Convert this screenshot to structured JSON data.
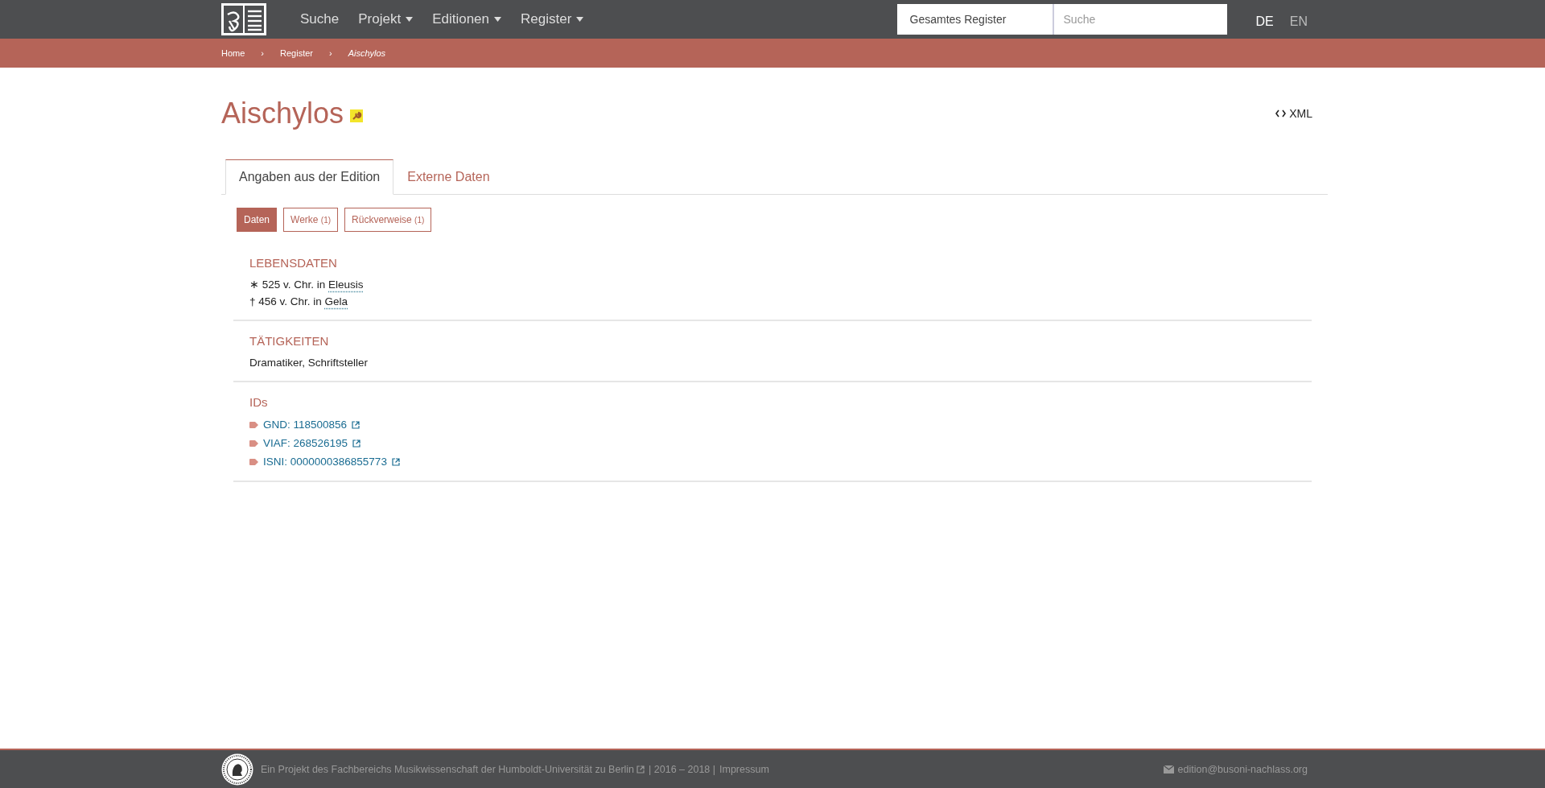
{
  "nav": {
    "items": [
      {
        "label": "Suche",
        "has_menu": false
      },
      {
        "label": "Projekt",
        "has_menu": true
      },
      {
        "label": "Editionen",
        "has_menu": true
      },
      {
        "label": "Register",
        "has_menu": true
      }
    ],
    "search": {
      "scope": "Gesamtes Register",
      "placeholder": "Suche"
    },
    "languages": [
      {
        "label": "DE",
        "selected": true
      },
      {
        "label": "EN",
        "selected": false
      }
    ]
  },
  "breadcrumb": [
    {
      "label": "Home",
      "current": false
    },
    {
      "label": "Register",
      "current": false
    },
    {
      "label": "Aischylos",
      "current": true
    }
  ],
  "separator": "›",
  "title": "Aischylos",
  "xml_link": "XML",
  "tabs": [
    {
      "label": "Angaben aus der Edition",
      "selected": true
    },
    {
      "label": "Externe Daten",
      "selected": false
    }
  ],
  "pills": [
    {
      "label": "Daten",
      "selected": true
    },
    {
      "label": "Werke",
      "count": "(1)",
      "selected": false
    },
    {
      "label": "Rückverweise",
      "count": "(1)",
      "selected": false
    }
  ],
  "sections": [
    {
      "heading": "LEBENSDATEN",
      "kind": "places",
      "lines": [
        {
          "text": "∗ 525 v. Chr. in",
          "place": "Eleusis"
        },
        {
          "text": "† 456 v. Chr. in",
          "place": "Gela"
        }
      ]
    },
    {
      "heading": "TÄTIGKEITEN",
      "kind": "text",
      "text": "Dramatiker, Schriftsteller"
    },
    {
      "heading": "IDs",
      "kind": "ids",
      "ids": [
        "GND: 118500856",
        "VIAF: 268526195",
        "ISNI: 0000000386855773"
      ]
    }
  ],
  "footer": {
    "project_link": "Ein Projekt des Fachbereichs Musikwissenschaft der Humboldt-Universität zu Berlin",
    "years": "| 2016 – 2018 |",
    "impressum": "Impressum",
    "email": "edition@busoni-nachlass.org"
  }
}
